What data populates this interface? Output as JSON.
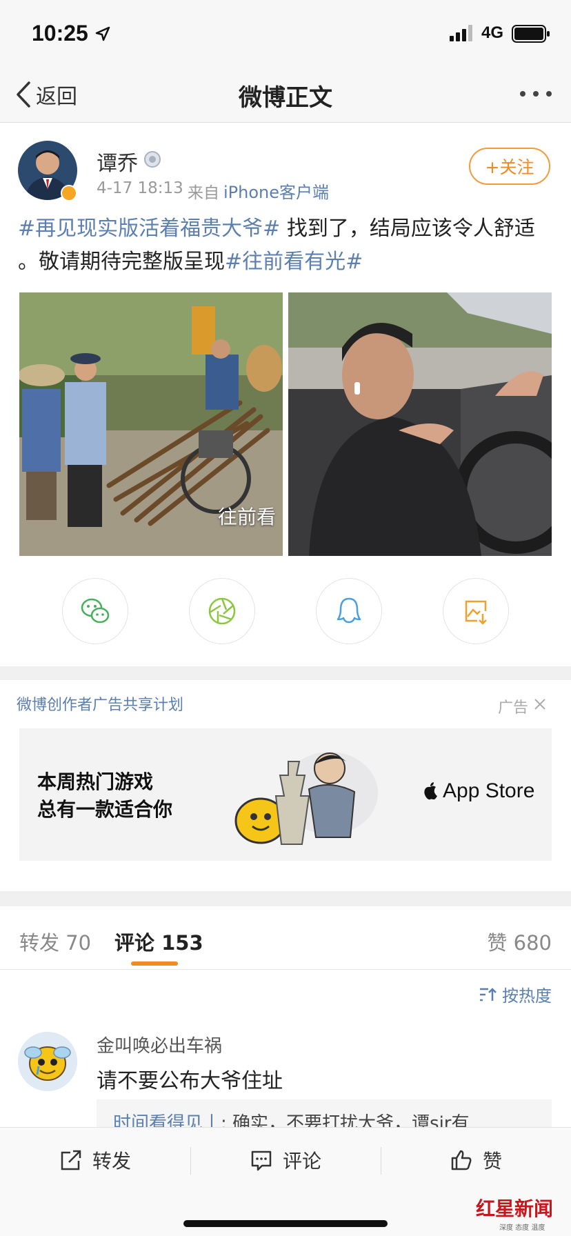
{
  "status_bar": {
    "time": "10:25",
    "network": "4G"
  },
  "nav": {
    "back_label": "返回",
    "title": "微博正文"
  },
  "post": {
    "author": "谭乔",
    "time": "4-17 18:13",
    "source_prefix": "来自",
    "source_device": "iPhone客户端",
    "follow_label": "+关注",
    "tag1": "#再见现实版活着福贵大爷#",
    "text1": " 找到了，结局应该令人舒适 。敬请期待完整版呈现",
    "tag2": "#往前看有光#",
    "photo1_caption": "往前看"
  },
  "share": [
    "wechat-icon",
    "moments-icon",
    "qq-icon",
    "save-image-icon"
  ],
  "ad": {
    "program": "微博创作者广告共享计划",
    "tag": "广告",
    "line1": "本周热门游戏",
    "line2": "总有一款适合你",
    "store": "App Store"
  },
  "tabs": {
    "repost": "转发 70",
    "comment": "评论 153",
    "like": "赞 680"
  },
  "sort_label": "按热度",
  "comment": {
    "user": "金叫唤必出车祸",
    "text": "请不要公布大爷住址",
    "reply_user": "时间看得见丨",
    "reply_text": ": 确实，不要打扰大爷，谭sir有"
  },
  "bottom_bar": {
    "repost": "转发",
    "comment": "评论",
    "like": "赞"
  },
  "watermark": {
    "logo": "红星新闻",
    "slogan": "深度 态度 温度"
  },
  "colors": {
    "link": "#5b7fb0",
    "accent": "#f08a24",
    "verified": "#f5a623"
  }
}
